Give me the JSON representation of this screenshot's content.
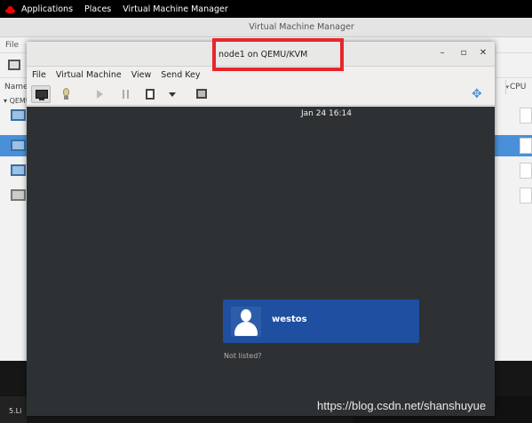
{
  "topbar": {
    "applications": "Applications",
    "places": "Places",
    "app_menu": "Virtual Machine Manager"
  },
  "manager": {
    "title": "Virtual Machine Manager",
    "menu_file": "File",
    "col_name": "Name",
    "col_cpu": "CPU",
    "group_label": "QEMU"
  },
  "viewer": {
    "title": "node1 on QEMU/KVM",
    "menu": [
      "File",
      "Virtual Machine",
      "View",
      "Send Key"
    ],
    "window_buttons": {
      "minimize": "–",
      "maximize": "▫",
      "close": "✕"
    }
  },
  "guest": {
    "clock": "Jan 24  16:14",
    "username": "westos",
    "not_listed": "Not listed?"
  },
  "taskbar": {
    "item_left": "5.Li"
  },
  "watermark": "https://blog.csdn.net/shanshuyue",
  "colors": {
    "highlight": "#e8262a",
    "user_tile": "#1f4fa0",
    "guest_bg": "#2e3133",
    "selection": "#4a90d9"
  }
}
